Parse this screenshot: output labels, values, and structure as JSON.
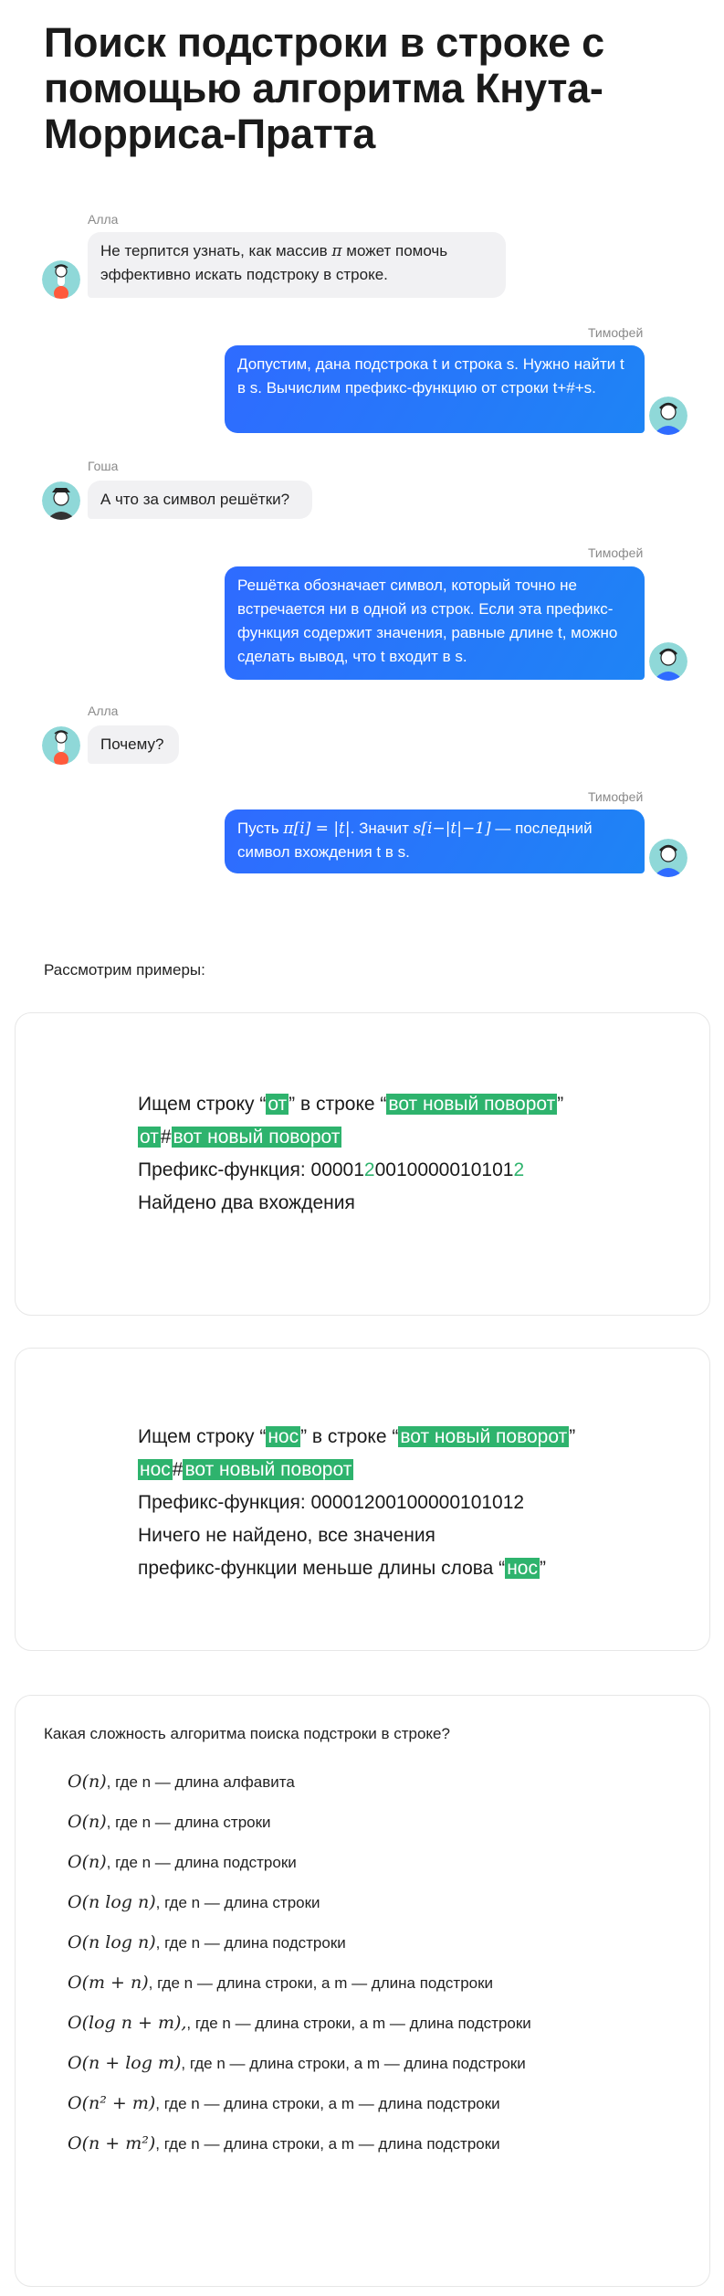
{
  "title": "Поиск подстроки в строке с помощью алгоритма Кнута-Морриса-Пратта",
  "chat": [
    {
      "author": "Алла",
      "text_a": "Не терпится узнать, как массив ",
      "math_a": "π",
      "text_b": " может помочь эффективно искать подстроку в строке."
    },
    {
      "author": "Тимофей",
      "text": "Допустим, дана подстрока t и строка s. Нужно найти t в s. Вычислим префикс-функцию от строки t+#+s."
    },
    {
      "author": "Гоша",
      "text": "А что за символ решётки?"
    },
    {
      "author": "Тимофей",
      "text": "Решётка обозначает символ, который точно не встречается ни в одной из строк. Если эта префикс-функция содержит значения, равные длине t, можно сделать вывод, что t входит в s."
    },
    {
      "author": "Алла",
      "text": "Почему?"
    },
    {
      "author": "Тимофей",
      "pre": "Пусть ",
      "math1": "π[i] = |t|",
      "mid": ". Значит ",
      "math2": "s[i−|t|−1]",
      "post": " — последний символ вхождения t в s."
    }
  ],
  "examples_intro": "Рассмотрим примеры:",
  "example1": {
    "l1_a": "Ищем строку “",
    "l1_word": "от",
    "l1_b": "” в строке “",
    "l1_str": "вот новый поворот",
    "l1_c": "”",
    "l2_word": "от",
    "l2_hash": "#",
    "l2_str": "вот новый поворот ",
    "l3_label": "Префикс-функция: ",
    "l3_a": "00001",
    "l3_b": "2",
    "l3_c": "0010000010101",
    "l3_d": "2",
    "l4": "Найдено два вхождения"
  },
  "example2": {
    "l1_a": "Ищем строку “",
    "l1_word": "нос",
    "l1_b": "” в строке “",
    "l1_str": "вот новый поворот",
    "l1_c": "”",
    "l2_word": "нос",
    "l2_hash": "#",
    "l2_str": "вот новый поворот ",
    "l3": "Префикс-функция: 00001200100000101012",
    "l4": "Ничего не найдено, все значения",
    "l5_a": "префикс-функции меньше длины слова “",
    "l5_word": "нос",
    "l5_b": "”"
  },
  "quiz": {
    "question": "Какая сложность алгоритма поиска подстроки в строке?",
    "options": [
      {
        "math": "O(n)",
        "text": ", где n — длина алфавита"
      },
      {
        "math": "O(n)",
        "text": ", где n — длина строки"
      },
      {
        "math": "O(n)",
        "text": ", где n — длина подстроки"
      },
      {
        "math": "O(n log n)",
        "text": ", где n — длина строки"
      },
      {
        "math": "O(n log n)",
        "text": ", где n — длина подстроки"
      },
      {
        "math": "O(m + n)",
        "text": ", где n — длина строки, а m — длина подстроки"
      },
      {
        "math": "O(log n + m),",
        "text": ", где n — длина строки, а m — длина подстроки"
      },
      {
        "math": "O(n + log m)",
        "text": ", где n — длина строки, а m — длина подстроки"
      },
      {
        "math": "O(n² + m)",
        "text": ", где n — длина строки, а m — длина подстроки"
      },
      {
        "math": "O(n + m²)",
        "text": ", где n — длина строки, а m — длина подстроки"
      }
    ]
  },
  "colors": {
    "accent_blue": "#2f6bff",
    "highlight_green": "#2eb36d",
    "bubble_gray": "#f1f1f3"
  }
}
